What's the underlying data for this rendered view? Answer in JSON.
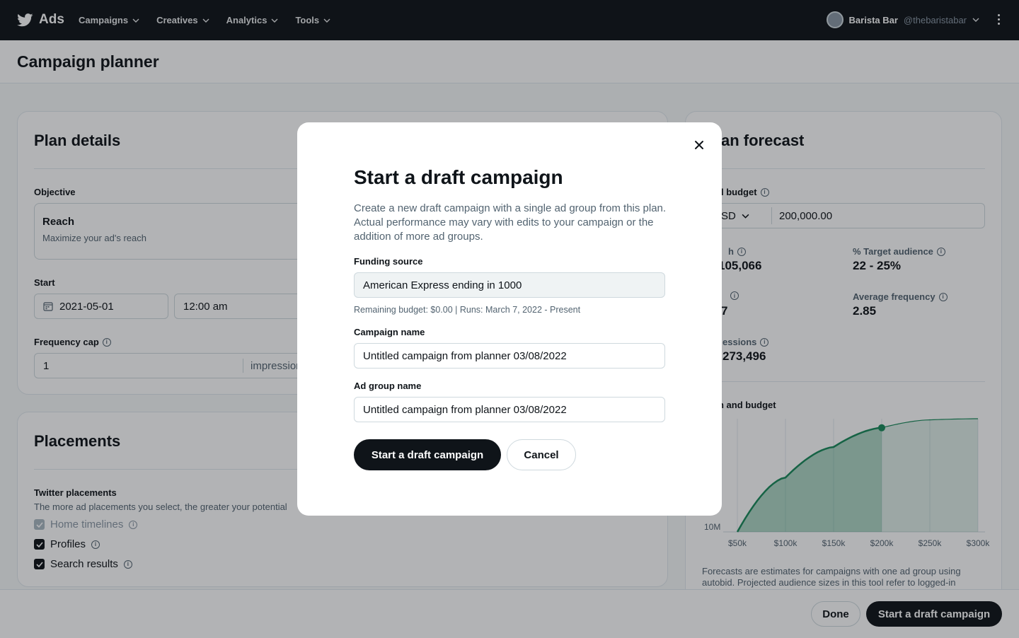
{
  "nav": {
    "brand": "Ads",
    "menu": [
      "Campaigns",
      "Creatives",
      "Analytics",
      "Tools"
    ],
    "account_name": "Barista Bar",
    "account_handle": "@thebaristabar"
  },
  "page": {
    "title": "Campaign planner"
  },
  "plan_details": {
    "title": "Plan details",
    "objective_label": "Objective",
    "objective_name": "Reach",
    "objective_desc": "Maximize your ad's reach",
    "start_label": "Start",
    "start_date": "2021-05-01",
    "start_time": "12:00 am",
    "frequency_label": "Frequency cap",
    "frequency_value": "1",
    "frequency_unit": "impression"
  },
  "placements": {
    "title": "Placements",
    "subtitle": "Twitter placements",
    "desc": "The more ad placements you select, the greater your potential",
    "items": [
      {
        "label": "Home timelines",
        "checked": true,
        "disabled": true
      },
      {
        "label": "Profiles",
        "checked": true,
        "disabled": false
      },
      {
        "label": "Search results",
        "checked": true,
        "disabled": false
      }
    ]
  },
  "forecast": {
    "title": "an forecast",
    "budget_label": "l budget",
    "currency": "SD",
    "budget_value": "200,000.00",
    "metrics": [
      {
        "label": "h",
        "value": "105,066"
      },
      {
        "label": "% Target audience",
        "value": "22 - 25%"
      },
      {
        "label": "",
        "value": "7"
      },
      {
        "label": "Average frequency",
        "value": "2.85"
      },
      {
        "label": "essions",
        "value": "273,496"
      }
    ],
    "chart_title": "h and budget",
    "note": "Forecasts are estimates for campaigns with one ad group using autobid. Projected audience sizes in this tool refer to logged-in"
  },
  "chart_data": {
    "type": "area",
    "title": "h and budget",
    "x_ticks": [
      "$50k",
      "$100k",
      "$150k",
      "$200k",
      "$250k",
      "$300k"
    ],
    "y_ticks": [
      "10M"
    ],
    "x": [
      50000,
      100000,
      150000,
      200000,
      250000,
      300000
    ],
    "series": [
      {
        "values": [
          0.0,
          0.48,
          0.75,
          0.92,
          0.99,
          1.0
        ]
      }
    ],
    "highlight_x": 200000,
    "color": "#1a8a5a"
  },
  "bottombar": {
    "done": "Done",
    "start": "Start a draft campaign"
  },
  "modal": {
    "title": "Start a draft campaign",
    "desc": "Create a new draft campaign with a single ad group from this plan. Actual performance may vary with edits to your campaign or the addition of more ad groups.",
    "funding_label": "Funding source",
    "funding_value": "American Express ending in 1000",
    "funding_hint": "Remaining budget: $0.00 | Runs: March 7, 2022 - Present",
    "campaign_label": "Campaign name",
    "campaign_value": "Untitled campaign from planner 03/08/2022",
    "adgroup_label": "Ad group name",
    "adgroup_value": "Untitled campaign from planner 03/08/2022",
    "primary_button": "Start a draft campaign",
    "cancel_button": "Cancel"
  }
}
